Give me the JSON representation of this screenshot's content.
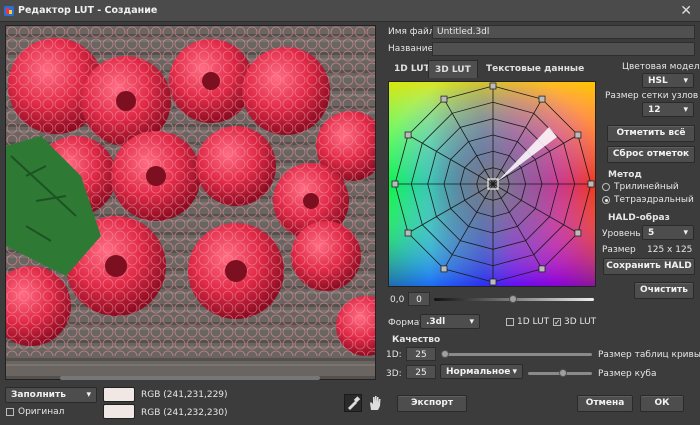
{
  "window": {
    "title": "Редактор LUT - Создание",
    "close_glyph": "✕"
  },
  "file": {
    "name_label": "Имя файла",
    "name_value": "Untitled.3dl",
    "title_label": "Название",
    "title_value": ""
  },
  "tabs": [
    "1D LUT",
    "3D LUT",
    "Текстовые данные"
  ],
  "color_model": {
    "label": "Цветовая модель",
    "value": "HSL"
  },
  "grid_size": {
    "label": "Размер сетки узлов",
    "value": "12"
  },
  "buttons": {
    "mark_all": "Отметить всё",
    "reset_marks": "Сброс отметок",
    "save_hald": "Сохранить HALD",
    "clear": "Очистить",
    "export": "Экспорт",
    "cancel": "Отмена",
    "ok": "ОК",
    "fill": "Заполнить"
  },
  "method": {
    "label": "Метод",
    "options": [
      "Трилинейный",
      "Тетраэдральный"
    ],
    "selected": 1
  },
  "hald": {
    "label": "HALD-образ",
    "level_label": "Уровень",
    "level_value": "5",
    "size_label": "Размер",
    "size_value": "125 x 125"
  },
  "value_slider": {
    "label": "0,0",
    "value": "0"
  },
  "format": {
    "label": "Формат",
    "value": ".3dl",
    "lut1d_label": "1D LUT",
    "lut1d_checked": false,
    "lut3d_label": "3D LUT",
    "lut3d_checked": true
  },
  "quality": {
    "label": "Качество",
    "row1_label": "1D:",
    "row1_value": "25",
    "row1_caption": "Размер таблиц кривых",
    "row2_label": "3D:",
    "row2_value": "25",
    "row2_mode": "Нормальное",
    "row2_caption": "Размер куба"
  },
  "swatches": {
    "rgb1": "RGB (241,231,229)",
    "rgb2": "RGB (241,232,230)",
    "color1": "#f1e7e5",
    "color2": "#f1e8e6"
  },
  "original": {
    "label": "Оригинал",
    "checked": false
  },
  "icons": [
    "eyedropper-icon",
    "hand-icon",
    "chevron-down-icon",
    "app-icon",
    "close-icon"
  ]
}
